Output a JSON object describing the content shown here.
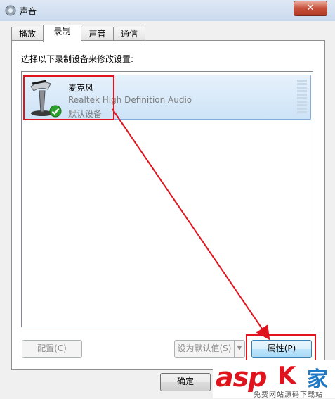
{
  "window": {
    "title": "声音",
    "close_label": "✕"
  },
  "tabs": [
    {
      "label": "播放",
      "active": false
    },
    {
      "label": "录制",
      "active": true
    },
    {
      "label": "声音",
      "active": false
    },
    {
      "label": "通信",
      "active": false
    }
  ],
  "main": {
    "instruction": "选择以下录制设备来修改设置:",
    "device": {
      "name": "麦克风",
      "description": "Realtek High Definition Audio",
      "status": "默认设备",
      "icon": "microphone-icon",
      "badge_icon": "default-check-icon"
    }
  },
  "buttons": {
    "configure": "配置(C)",
    "set_default": "设为默认值(S)",
    "properties": "属性(P)",
    "ok": "确定"
  },
  "watermark": {
    "brand_latin": "asp",
    "brand_ku": "K",
    "brand_jia": "家",
    "subtitle": "免费网站源码下载站"
  },
  "colors": {
    "annotation_red": "#e0141c",
    "selection_blue": "#cde3f7",
    "check_green": "#2da12d"
  }
}
